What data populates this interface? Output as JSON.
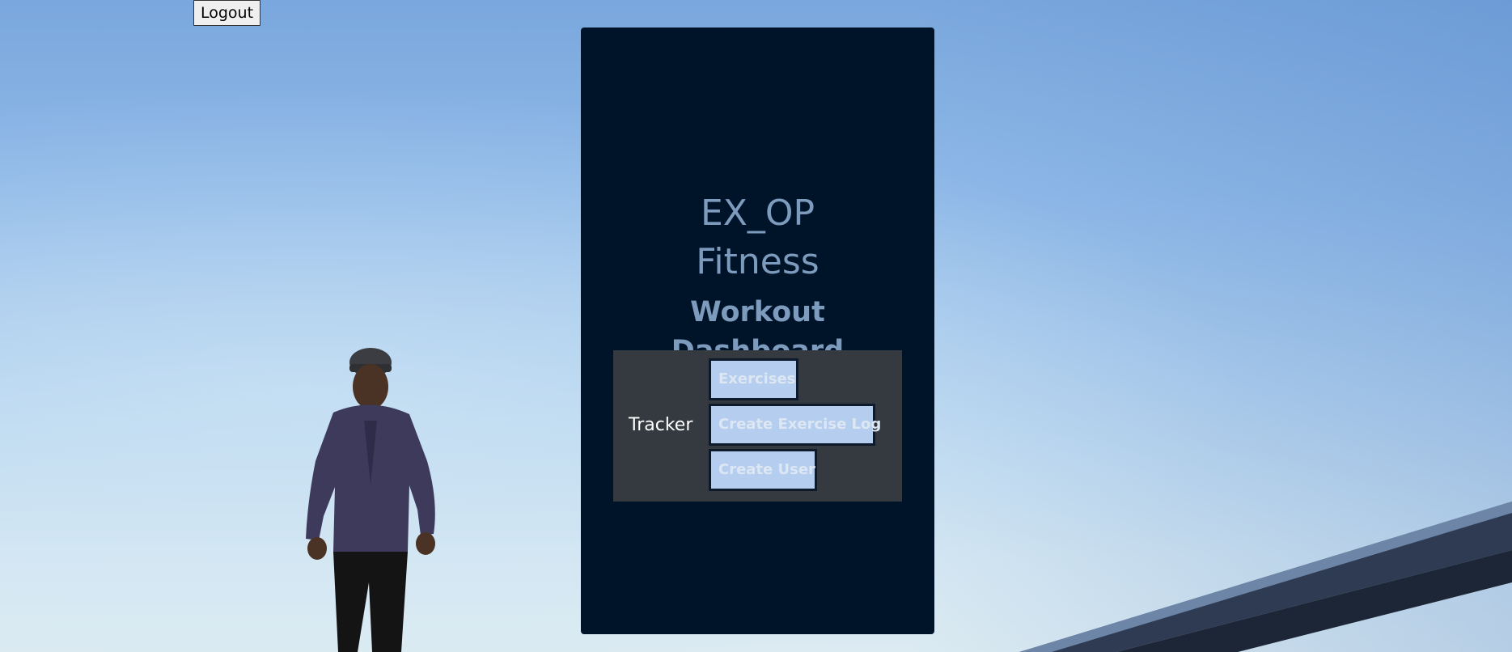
{
  "header": {
    "logout_label": "Logout"
  },
  "card": {
    "title_line1": "EX_OP",
    "title_line2": "Fitness",
    "subtitle_line1": "Workout",
    "subtitle_line2": "Dashboard"
  },
  "nav": {
    "brand": "Tracker",
    "items": [
      {
        "label": "Exercises"
      },
      {
        "label": "Create Exercise Log"
      },
      {
        "label": "Create User"
      }
    ]
  },
  "colors": {
    "card_bg": "#001429",
    "title_text": "#7c9bbd",
    "nav_panel_bg": "#343a40",
    "nav_button_bg": "#b5cdee"
  }
}
